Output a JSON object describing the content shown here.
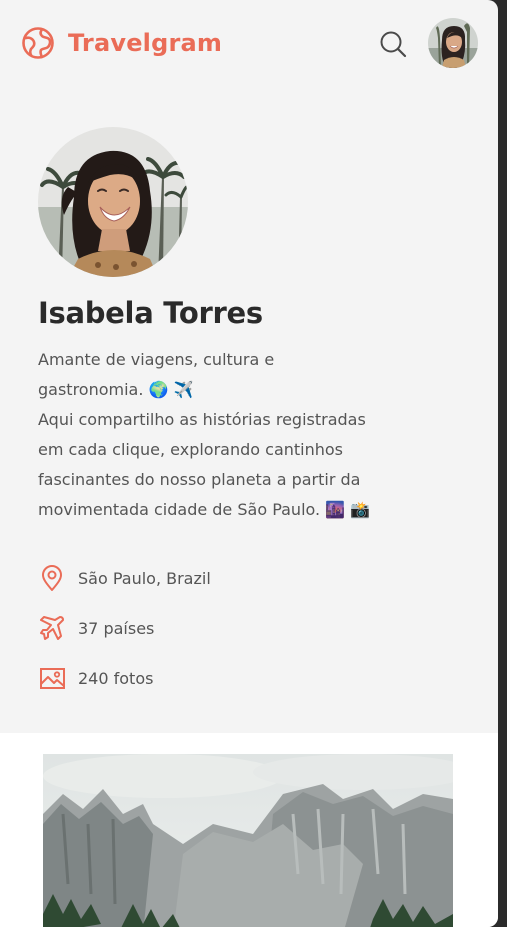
{
  "header": {
    "brand": "Travelgram",
    "brand_icon": "globe-icon",
    "search_icon": "search-icon",
    "accent_color": "#ea6c57"
  },
  "profile": {
    "name": "Isabela Torres",
    "bio_lines": [
      "Amante de viagens, cultura e",
      "gastronomia. 🌍 ✈️",
      "Aqui compartilho as histórias registradas",
      "em cada clique, explorando cantinhos",
      "fascinantes do nosso planeta a partir da",
      "movimentada cidade de São Paulo. 🌆 📸"
    ],
    "stats": [
      {
        "icon": "location-pin-icon",
        "text": "São Paulo, Brazil"
      },
      {
        "icon": "airplane-icon",
        "text": "37 países"
      },
      {
        "icon": "image-icon",
        "text": "240 fotos"
      }
    ]
  },
  "feed": {
    "first_photo": "mountain-landscape-photo"
  }
}
